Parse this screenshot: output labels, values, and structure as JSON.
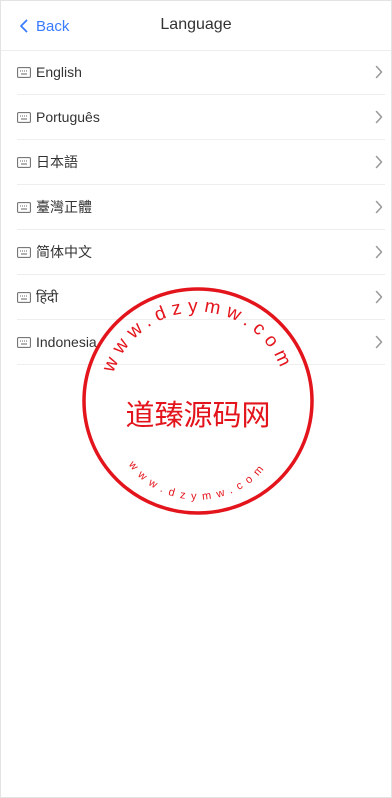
{
  "header": {
    "back_label": "Back",
    "title": "Language"
  },
  "languages": [
    {
      "label": "English"
    },
    {
      "label": "Português"
    },
    {
      "label": "日本語"
    },
    {
      "label": "臺灣正體"
    },
    {
      "label": "简体中文"
    },
    {
      "label": "हिंदी"
    },
    {
      "label": "Indonesia"
    }
  ],
  "watermark": {
    "center_text": "道臻源码网",
    "ring_text_top": "www.dzymw.com",
    "ring_text_bottom": "www.dzymw.com",
    "color": "#e3141b"
  },
  "colors": {
    "accent": "#3a7cff",
    "divider": "#eeeeee"
  }
}
